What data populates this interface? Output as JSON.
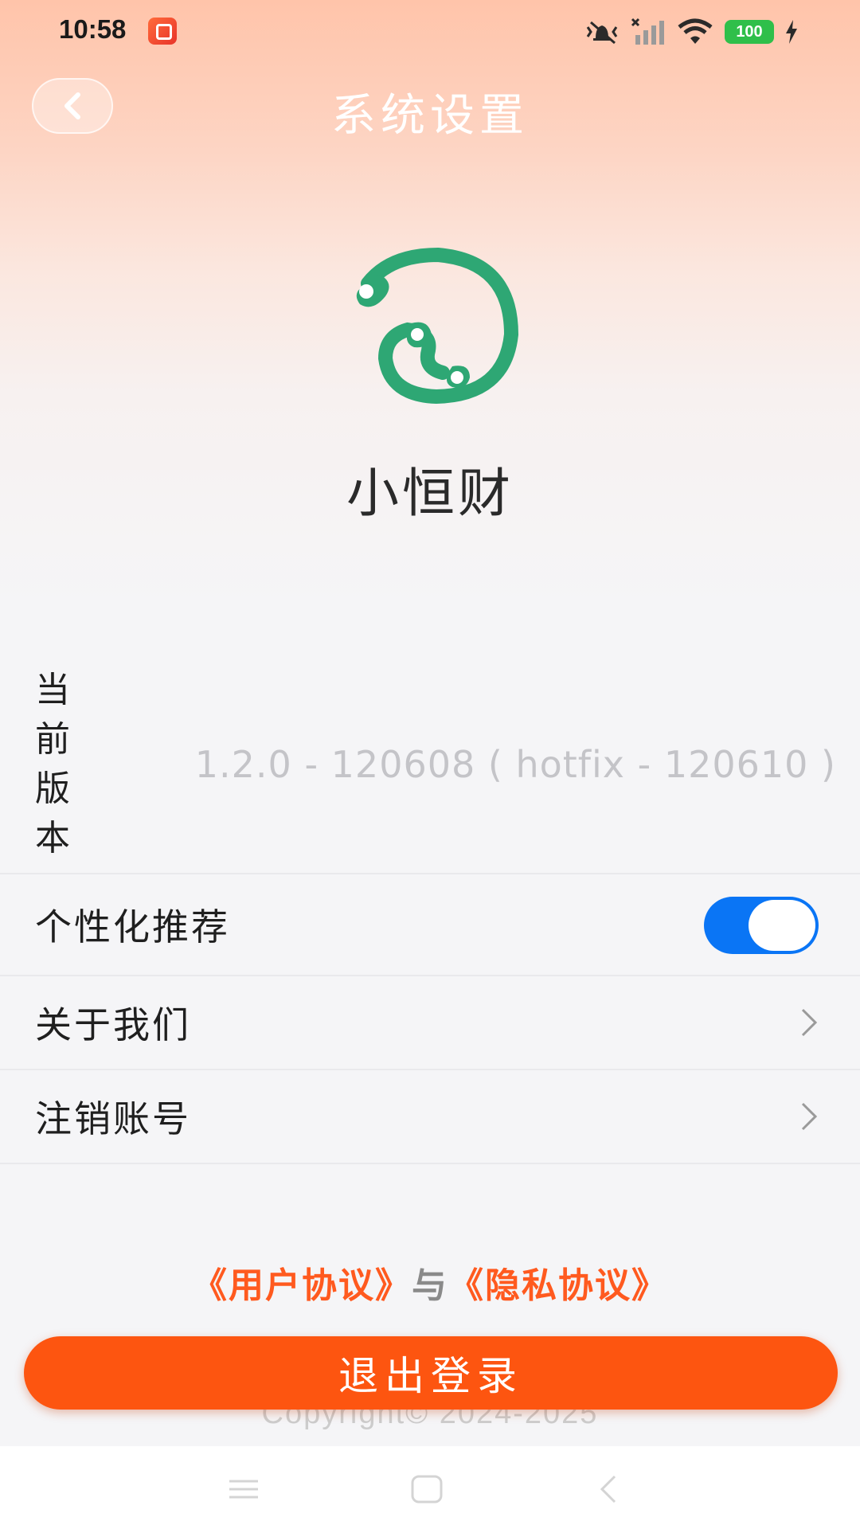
{
  "status_bar": {
    "time": "10:58",
    "icons": [
      "app-notification-icon",
      "mute-vibrate-icon",
      "signal-icon",
      "wifi-icon",
      "battery-icon",
      "charging-icon"
    ],
    "battery": "100"
  },
  "header": {
    "back_icon": "chevron-left-icon",
    "title": "系统设置"
  },
  "app": {
    "logo_icon": "app-logo",
    "logo_color": "#2ea774",
    "name": "小恒财"
  },
  "settings": {
    "version": {
      "label": "当前版本",
      "value": "1.2.0 - 120608 ( hotfix - 120610 )"
    },
    "personalized": {
      "label": "个性化推荐",
      "enabled": true
    },
    "about": {
      "label": "关于我们"
    },
    "cancel_account": {
      "label": "注销账号"
    }
  },
  "footer": {
    "user_agreement": "《用户协议》",
    "conjunction": "与",
    "privacy_agreement": "《隐私协议》",
    "logout_label": "退出登录",
    "copyright": "Copyright© 2024-2025"
  },
  "colors": {
    "accent": "#fd5510",
    "toggle_on": "#0a75f5",
    "link": "#ff5a1f"
  },
  "nav_bar": {
    "icons": [
      "menu-icon",
      "home-icon",
      "back-icon"
    ]
  }
}
